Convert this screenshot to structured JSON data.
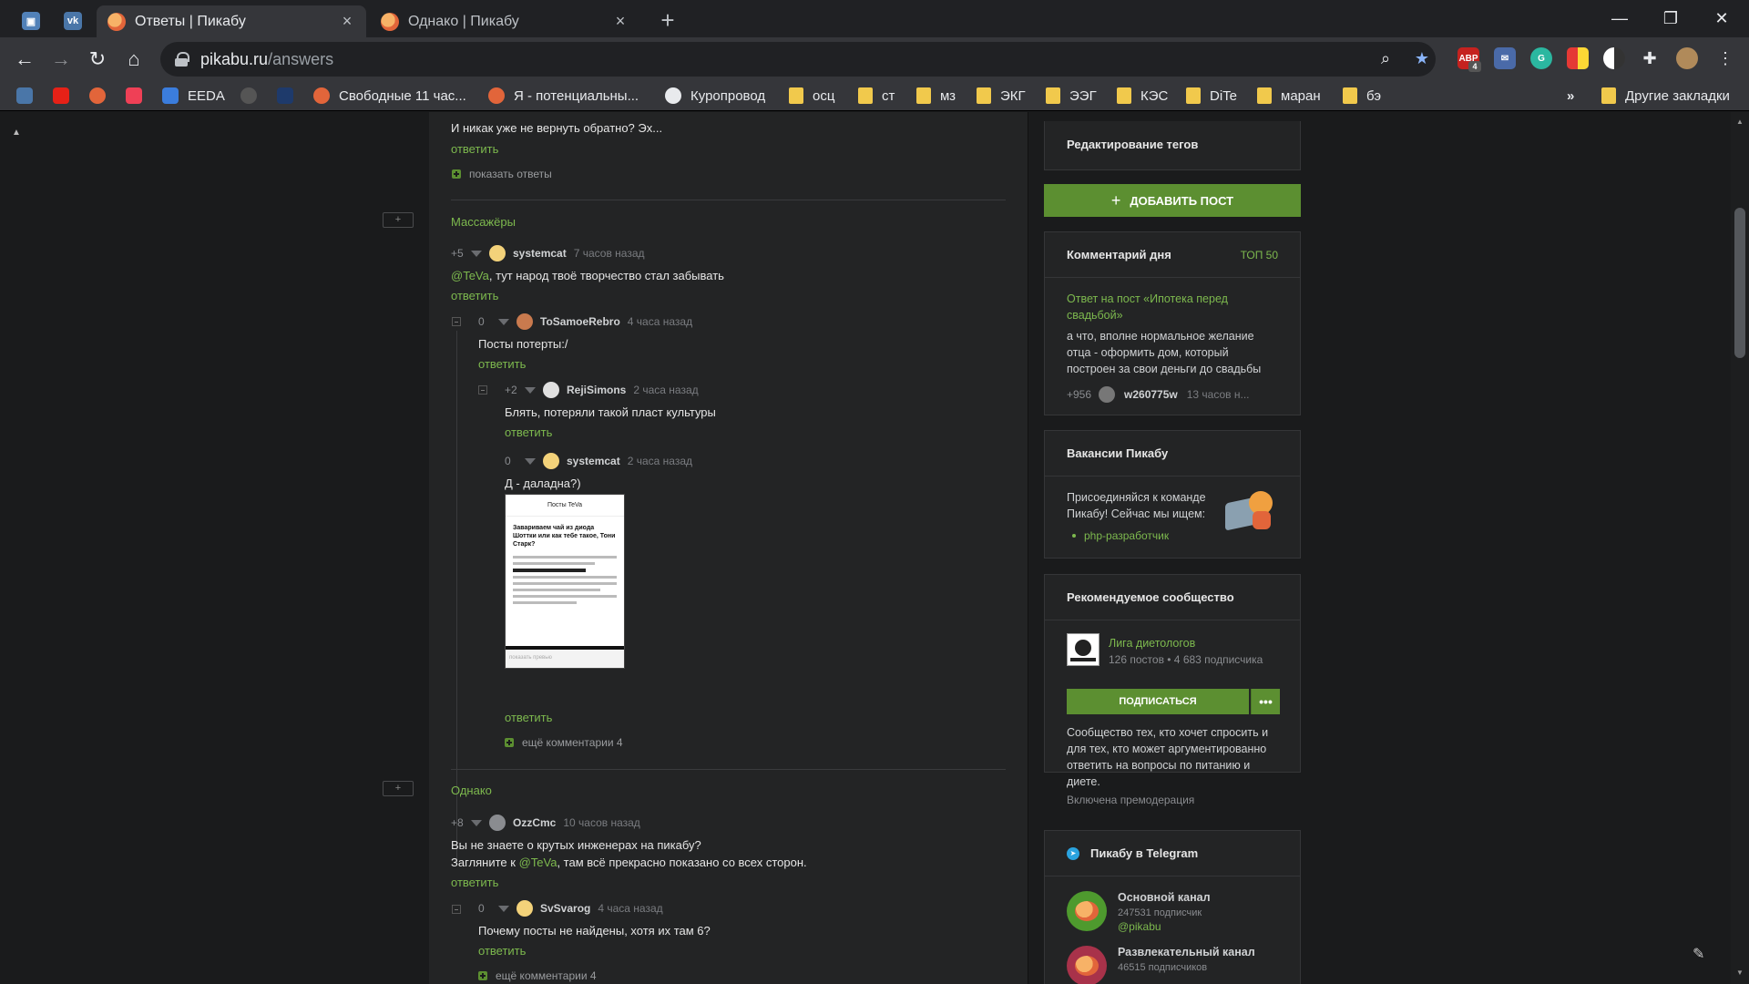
{
  "browser": {
    "tabs": [
      {
        "title": "Ответы | Пикабу",
        "active": true
      },
      {
        "title": "Однако | Пикабу",
        "active": false
      }
    ],
    "url_host": "pikabu.ru",
    "url_path": "/answers",
    "ext_abp_badge": "4",
    "bookmarks": [
      {
        "label": "EEDA",
        "type": "site"
      },
      {
        "label": "Свободные 11 час...",
        "type": "site"
      },
      {
        "label": "Я - потенциальны...",
        "type": "site"
      },
      {
        "label": "Куропровод",
        "type": "site"
      },
      {
        "label": "осц",
        "type": "folder"
      },
      {
        "label": "ст",
        "type": "folder"
      },
      {
        "label": "мз",
        "type": "folder"
      },
      {
        "label": "ЭКГ",
        "type": "folder"
      },
      {
        "label": "ЭЭГ",
        "type": "folder"
      },
      {
        "label": "КЭС",
        "type": "folder"
      },
      {
        "label": "DiTe",
        "type": "folder"
      },
      {
        "label": "маран",
        "type": "folder"
      },
      {
        "label": "бэ",
        "type": "folder"
      }
    ],
    "bookmarks_overflow": "»",
    "other_bookmarks": "Другие закладки"
  },
  "feed": {
    "top": {
      "text": "И никак уже не вернуть обратно? Эх...",
      "reply": "ответить",
      "show_answers": "показать ответы"
    },
    "post1": {
      "title": "Массажёры",
      "c1": {
        "rating": "+5",
        "user": "systemcat",
        "time": "7 часов назад",
        "mention": "@TeVa",
        "text": ", тут народ твоё творчество стал забывать",
        "reply": "ответить"
      },
      "c2": {
        "rating": "0",
        "user": "ToSamoeRebro",
        "time": "4 часа назад",
        "text": "Посты потерты:/",
        "reply": "ответить"
      },
      "c3": {
        "rating": "+2",
        "user": "RejiSimons",
        "time": "2 часа назад",
        "text": "Блять, потеряли такой пласт культуры",
        "reply": "ответить"
      },
      "c4": {
        "rating": "0",
        "user": "systemcat",
        "time": "2 часа назад",
        "text": "Д - даладна?)",
        "reply": "ответить"
      },
      "more": "ещё комментарии 4"
    },
    "post2": {
      "title": "Однако",
      "c1": {
        "rating": "+8",
        "user": "OzzCmc",
        "time": "10 часов назад",
        "line1": "Вы не знаете о крутых инженерах на пикабу?",
        "line2_pre": "Загляните к ",
        "mention": "@TeVa",
        "line2_post": ", там всё прекрасно показано со всех сторон.",
        "reply": "ответить"
      },
      "c2": {
        "rating": "0",
        "user": "SvSvarog",
        "time": "4 часа назад",
        "text": "Почему посты не найдены, хотя их там 6?",
        "reply": "ответить"
      },
      "more": "ещё комментарии 4"
    }
  },
  "sidebar": {
    "edit_tags": "Редактирование тегов",
    "add_post": "ДОБАВИТЬ ПОСТ",
    "comment_of_day": {
      "title": "Комментарий дня",
      "top": "ТОП 50",
      "post_link": "Ответ на пост «Ипотека перед свадьбой»",
      "text": "а что, вполне нормальное желание отца - оформить дом, который построен за свои деньги до свадьбы",
      "rating": "+956",
      "user": "w260775w",
      "time": "13 часов н..."
    },
    "vacancies": {
      "title": "Вакансии Пикабу",
      "text": "Присоединяйся к команде Пикабу! Сейчас мы ищем:",
      "item": "php-разработчик"
    },
    "community": {
      "title": "Рекомендуемое сообщество",
      "name": "Лига диетологов",
      "stats": "126 постов • 4 683 подписчика",
      "subscribe": "ПОДПИСАТЬСЯ",
      "more": "•••",
      "desc": "Сообщество тех, кто хочет спросить и для тех, кто может аргументированно ответить на вопросы по питанию и диете.",
      "moderation": "Включена премодерация"
    },
    "telegram": {
      "title": "Пикабу в Telegram",
      "ch1_name": "Основной канал",
      "ch1_subs": "247531 подписчик",
      "ch1_handle": "@pikabu",
      "ch2_name": "Развлекательный канал",
      "ch2_subs": "46515 подписчиков"
    }
  },
  "phone_screenshot": {
    "header": "Посты TeVa",
    "post_title": "Завариваем чай из диода Шоттки или как тебе такое, Тони Старк?",
    "footer": "показать превью"
  }
}
